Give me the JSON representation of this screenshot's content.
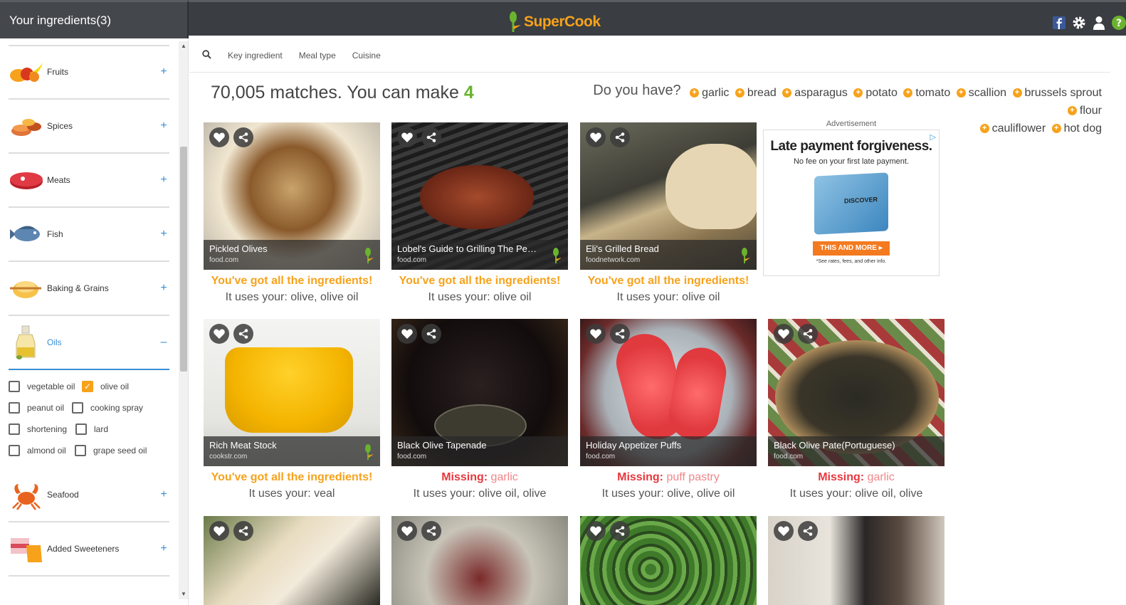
{
  "sidebar": {
    "title": "Your ingredients(3)",
    "categories": [
      {
        "label": "Fruits",
        "toggle": "+"
      },
      {
        "label": "Spices",
        "toggle": "+"
      },
      {
        "label": "Meats",
        "toggle": "+"
      },
      {
        "label": "Fish",
        "toggle": "+"
      },
      {
        "label": "Baking & Grains",
        "toggle": "+"
      },
      {
        "label": "Oils",
        "toggle": "–"
      },
      {
        "label": "Seafood",
        "toggle": "+"
      },
      {
        "label": "Added Sweeteners",
        "toggle": "+"
      }
    ],
    "oils": [
      {
        "label": "vegetable oil",
        "checked": false
      },
      {
        "label": "olive oil",
        "checked": true
      },
      {
        "label": "peanut oil",
        "checked": false
      },
      {
        "label": "cooking spray",
        "checked": false
      },
      {
        "label": "shortening",
        "checked": false
      },
      {
        "label": "lard",
        "checked": false
      },
      {
        "label": "almond oil",
        "checked": false
      },
      {
        "label": "grape seed oil",
        "checked": false
      }
    ]
  },
  "header": {
    "brand": "SuperCook",
    "accent": "#f7a21b",
    "icons": [
      "facebook-icon",
      "gear-icon",
      "user-icon",
      "help-icon"
    ]
  },
  "filters": {
    "search_icon": "search-icon",
    "items": [
      "Key ingredient",
      "Meal type",
      "Cuisine"
    ]
  },
  "summary": {
    "matches_text": "70,005 matches. You can make ",
    "can_make": "4"
  },
  "suggest": {
    "question": "Do you have?",
    "items": [
      "garlic",
      "bread",
      "asparagus",
      "potato",
      "tomato",
      "scallion",
      "brussels sprout",
      "flour",
      "cauliflower",
      "hot dog"
    ]
  },
  "recipes": [
    {
      "title": "Pickled Olives",
      "source": "food.com",
      "status": "You've got all the ingredients!",
      "missing": "",
      "uses": "It uses your: olive, olive oil"
    },
    {
      "title": "Lobel's Guide to Grilling The Perf...",
      "source": "food.com",
      "status": "You've got all the ingredients!",
      "missing": "",
      "uses": "It uses your: olive oil"
    },
    {
      "title": "Eli's Grilled Bread",
      "source": "foodnetwork.com",
      "status": "You've got all the ingredients!",
      "missing": "",
      "uses": "It uses your: olive oil"
    },
    {
      "title": "Rich Meat Stock",
      "source": "cookstr.com",
      "status": "You've got all the ingredients!",
      "missing": "",
      "uses": "It uses your: veal"
    },
    {
      "title": "Black Olive Tapenade",
      "source": "food.com",
      "status": "Missing:",
      "missing": "garlic",
      "uses": "It uses your: olive oil, olive"
    },
    {
      "title": "Holiday Appetizer Puffs",
      "source": "food.com",
      "status": "Missing:",
      "missing": "puff pastry",
      "uses": "It uses your: olive, olive oil"
    },
    {
      "title": "Black Olive Pate(Portuguese)",
      "source": "food.com",
      "status": "Missing:",
      "missing": "garlic",
      "uses": "It uses your: olive oil, olive"
    }
  ],
  "ad": {
    "label": "Advertisement",
    "headline": "Late payment forgiveness.",
    "sub": "No fee on your first late payment.",
    "card_brand": "DISCOVER",
    "cta": "THIS AND MORE ▸",
    "fine": "*See rates, fees, and other info."
  }
}
